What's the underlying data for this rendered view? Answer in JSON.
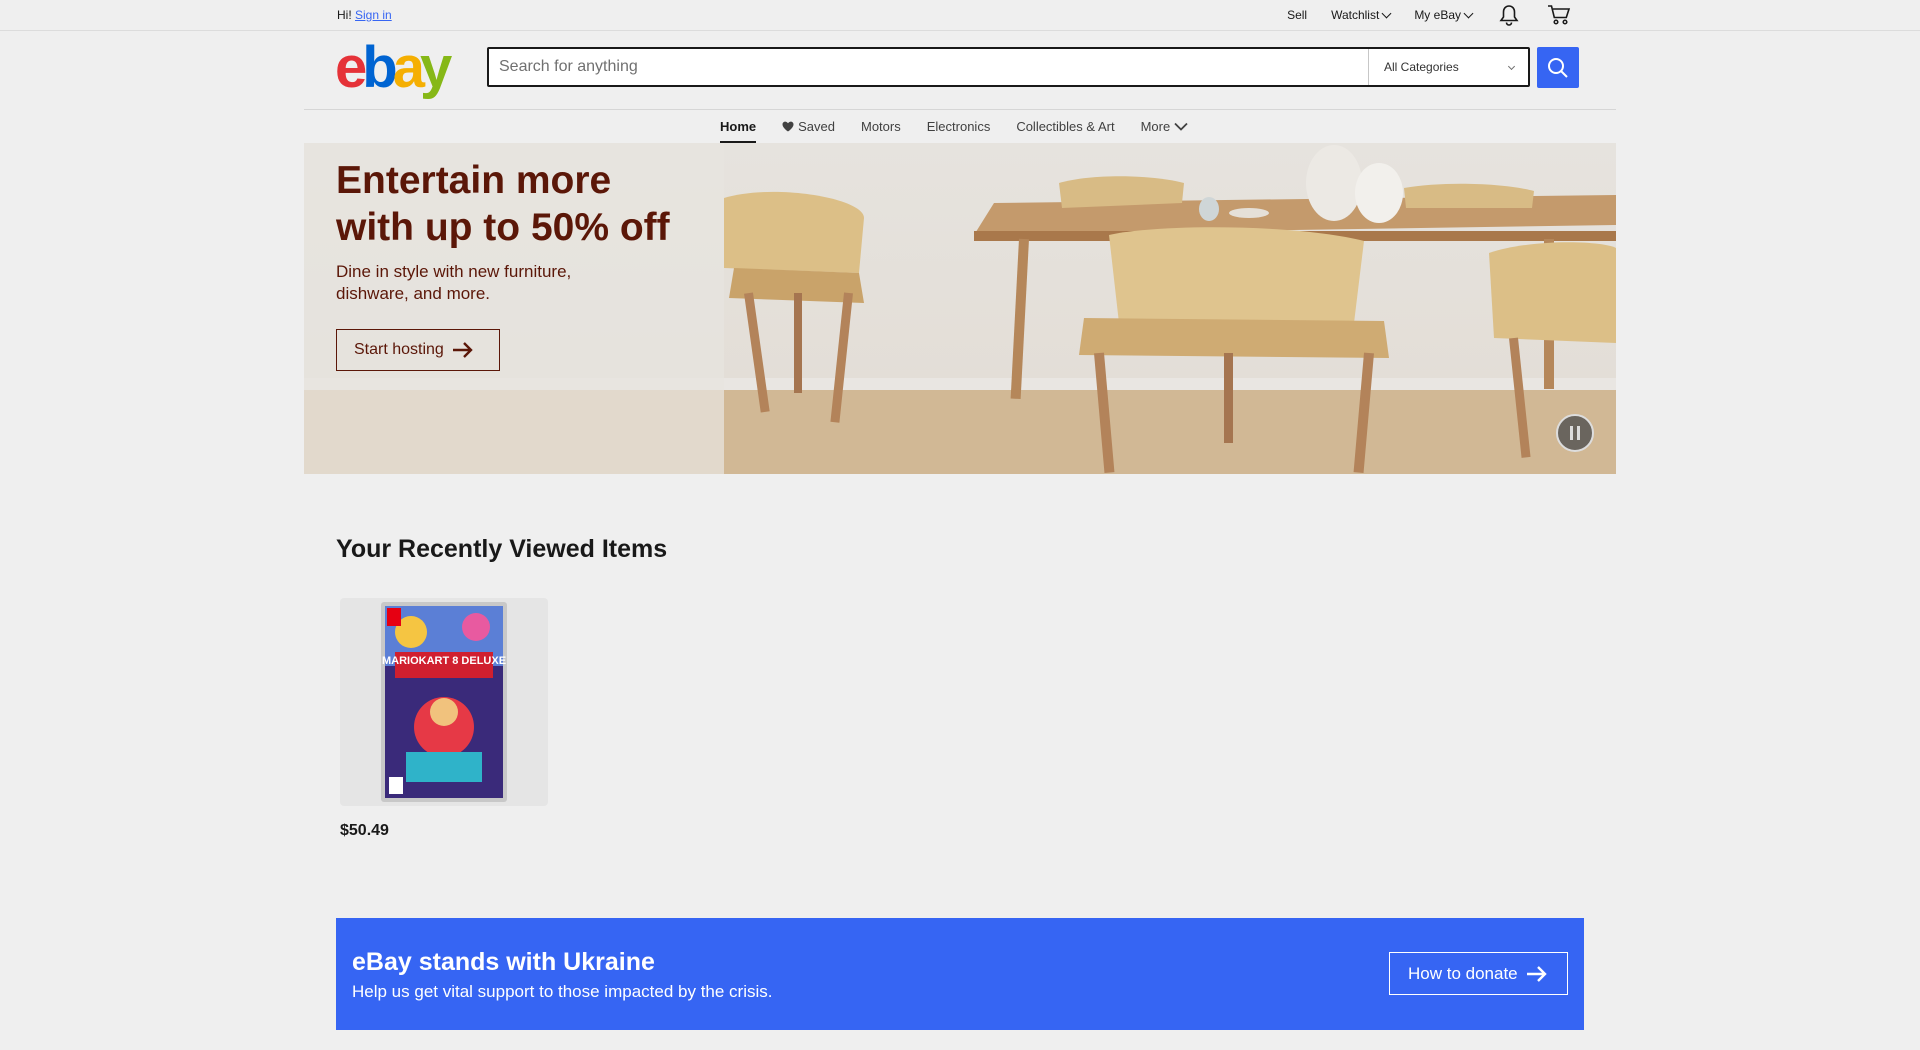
{
  "topbar": {
    "greeting": "Hi!",
    "signin": "Sign in",
    "sell": "Sell",
    "watchlist": "Watchlist",
    "myebay": "My eBay"
  },
  "header": {
    "logo": [
      "e",
      "b",
      "a",
      "y"
    ],
    "search_placeholder": "Search for anything",
    "category": "All Categories"
  },
  "nav": {
    "items": [
      "Home",
      "Saved",
      "Motors",
      "Electronics",
      "Collectibles & Art",
      "More"
    ]
  },
  "hero": {
    "title_line1": "Entertain more",
    "title_line2": "with up to 50% off",
    "subtitle_line1": "Dine in style with new furniture,",
    "subtitle_line2": "dishware, and more.",
    "cta": "Start hosting"
  },
  "recently_viewed": {
    "title": "Your Recently Viewed Items",
    "items": [
      {
        "price": "$50.49",
        "image_text": "MARIOKART 8 DELUXE"
      }
    ]
  },
  "ukraine": {
    "title": "eBay stands with Ukraine",
    "subtitle": "Help us get vital support to those impacted by the crisis.",
    "cta": "How to donate"
  },
  "colors": {
    "accent": "#3665f3",
    "hero_text": "#5b1708"
  }
}
